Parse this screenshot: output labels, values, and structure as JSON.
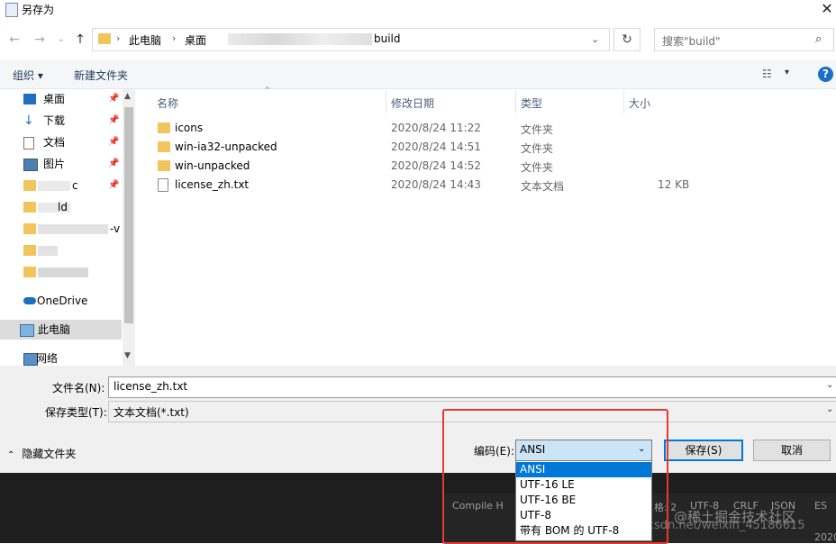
{
  "window": {
    "title": "另存为",
    "close_glyph": "✕"
  },
  "nav_buttons": {
    "back": "←",
    "forward": "→",
    "history": "⌄",
    "up": "↑"
  },
  "address": {
    "segments": [
      "此电脑",
      "桌面",
      "build"
    ],
    "separator": "›",
    "dropdown": "⌄"
  },
  "refresh_glyph": "↻",
  "search": {
    "placeholder": "搜索\"build\"",
    "icon_glyph": "⌕"
  },
  "toolbar": {
    "organize": "组织 ▾",
    "new_folder": "新建文件夹",
    "view_glyph": "☷",
    "view_dd": "▾",
    "help": "?"
  },
  "nav_pane": {
    "items": [
      {
        "label": "桌面",
        "icon": "desktop-icon",
        "pinned": true
      },
      {
        "label": "下载",
        "icon": "download-icon",
        "pinned": true
      },
      {
        "label": "文档",
        "icon": "documents-icon",
        "pinned": true
      },
      {
        "label": "图片",
        "icon": "pictures-icon",
        "pinned": true
      },
      {
        "label": "c",
        "icon": "folder-icon",
        "pinned": true
      },
      {
        "label": "ld",
        "icon": "folder-icon",
        "pinned": false
      },
      {
        "label": "-v",
        "icon": "folder-icon",
        "pinned": false
      },
      {
        "label": "",
        "icon": "folder-icon",
        "pinned": false
      },
      {
        "label": "",
        "icon": "folder-icon",
        "pinned": false
      }
    ],
    "onedrive": "OneDrive",
    "this_pc": "此电脑",
    "network": "网络",
    "pin_glyph": "📌"
  },
  "columns": {
    "name": "名称",
    "modified": "修改日期",
    "type": "类型",
    "size": "大小",
    "sort_glyph": "^"
  },
  "files": [
    {
      "name": "icons",
      "modified": "2020/8/24 11:22",
      "type": "文件夹",
      "size": "",
      "kind": "folder"
    },
    {
      "name": "win-ia32-unpacked",
      "modified": "2020/8/24 14:51",
      "type": "文件夹",
      "size": "",
      "kind": "folder"
    },
    {
      "name": "win-unpacked",
      "modified": "2020/8/24 14:52",
      "type": "文件夹",
      "size": "",
      "kind": "folder"
    },
    {
      "name": "license_zh.txt",
      "modified": "2020/8/24 14:43",
      "type": "文本文档",
      "size": "12 KB",
      "kind": "txt"
    }
  ],
  "form": {
    "filename_label": "文件名(N):",
    "filename_value": "license_zh.txt",
    "filetype_label": "保存类型(T):",
    "filetype_value": "文本文档(*.txt)",
    "hide_folders": "隐藏文件夹",
    "encoding_label": "编码(E):",
    "encoding_value": "ANSI",
    "encoding_options": [
      "ANSI",
      "UTF-16 LE",
      "UTF-16 BE",
      "UTF-8",
      "带有 BOM 的 UTF-8"
    ],
    "save": "保存(S)",
    "cancel": "取消"
  },
  "editor_status": {
    "compile": "Compile H",
    "items": [
      "格: 2",
      "UTF-8",
      "CRLF",
      "JSON",
      "ES"
    ],
    "clock": "2020"
  },
  "watermark": {
    "line1": "@稀土掘金技术社区",
    "line2": "https://blog.csdn.net/weixin_45186615"
  },
  "colors": {
    "accent": "#0078d7",
    "highlight_box": "#e53935",
    "folder": "#f2c55c"
  }
}
